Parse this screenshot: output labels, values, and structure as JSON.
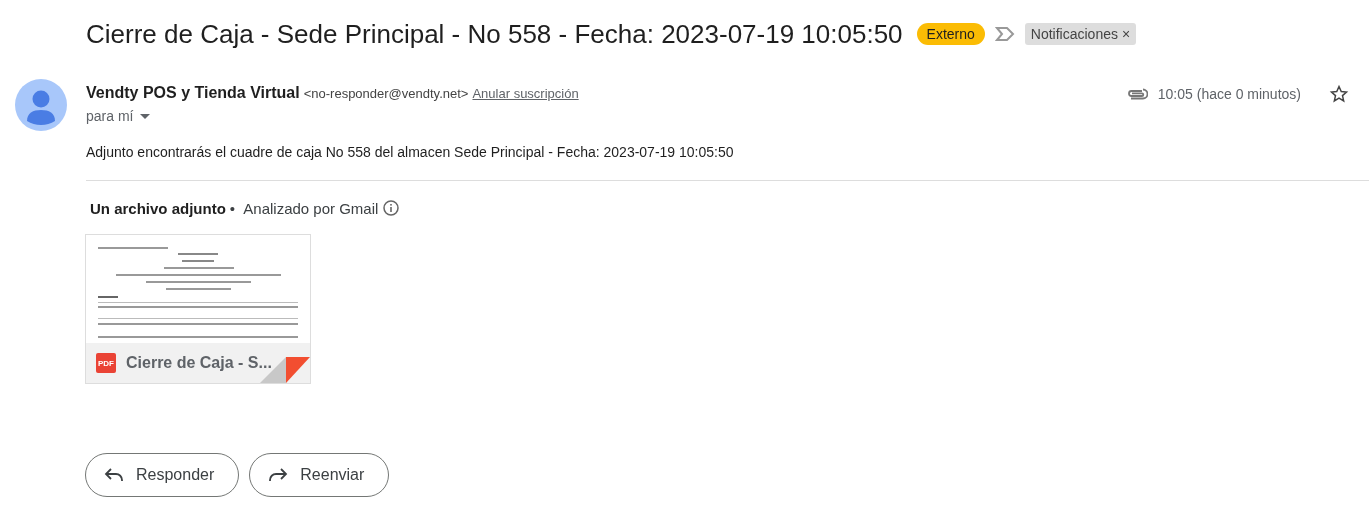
{
  "subject": "Cierre de Caja - Sede Principal - No 558 - Fecha: 2023-07-19 10:05:50",
  "labels": [
    {
      "kind": "badge",
      "text": "Externo"
    },
    {
      "kind": "removable",
      "text": "Notificaciones",
      "remove": "×"
    }
  ],
  "sender": {
    "name": "Vendty POS y Tienda Virtual",
    "email": "<no-responder@vendty.net>",
    "unsubscribe": "Anular suscripción",
    "recipient": "para mí",
    "time": "10:05 (hace 0 minutos)",
    "starred": false
  },
  "body": "Adjunto encontrarás el cuadre de caja No 558 del almacen Sede Principal - Fecha: 2023-07-19 10:05:50",
  "attachments_header": {
    "title": "Un archivo adjunto",
    "separator": "•",
    "scan": "Analizado por Gmail"
  },
  "attachments": [
    {
      "type": "PDF",
      "name": "Cierre de Caja - S..."
    }
  ],
  "actions": [
    {
      "kind": "reply",
      "label": "Responder"
    },
    {
      "kind": "forward",
      "label": "Reenviar"
    }
  ]
}
